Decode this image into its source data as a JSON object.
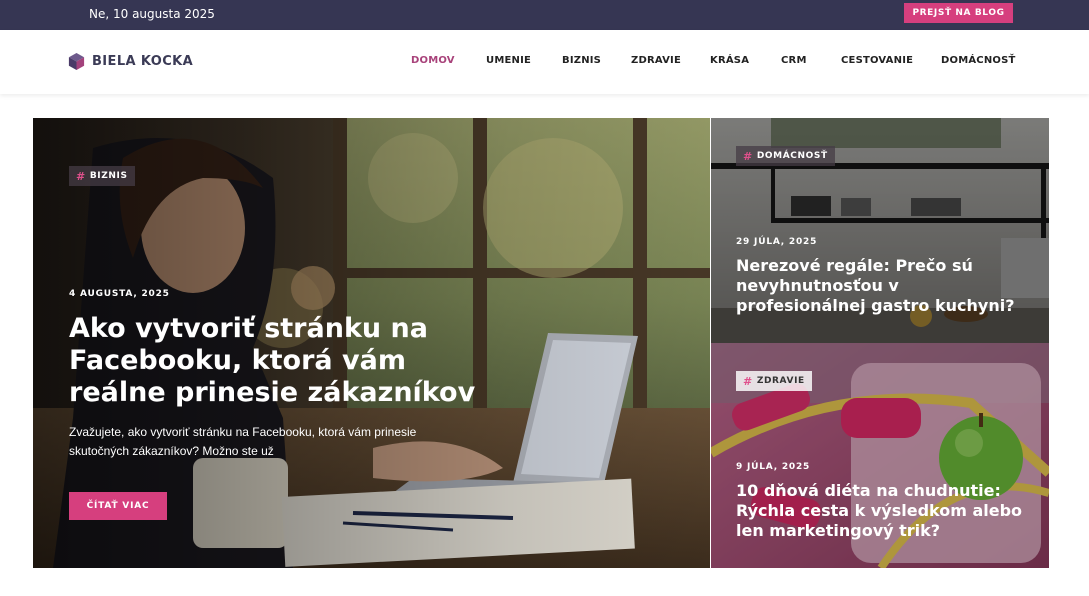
{
  "topbar": {
    "date": "Ne, 10 augusta 2025",
    "blog_button": "PREJSŤ NA BLOG"
  },
  "brand": {
    "name": "BIELA KOCKA",
    "logo_icon": "cube-icon"
  },
  "nav": {
    "items": [
      {
        "label": "DOMOV",
        "active": true
      },
      {
        "label": "UMENIE",
        "active": false
      },
      {
        "label": "BIZNIS",
        "active": false
      },
      {
        "label": "ZDRAVIE",
        "active": false
      },
      {
        "label": "KRÁSA",
        "active": false
      },
      {
        "label": "CRM",
        "active": false
      },
      {
        "label": "CESTOVANIE",
        "active": false
      },
      {
        "label": "DOMÁCNOSŤ",
        "active": false
      }
    ]
  },
  "featured": {
    "category": "BIZNIS",
    "date": "4 AUGUSTA, 2025",
    "title": "Ako vytvoriť stránku na Facebooku, ktorá vám reálne prinesie zákazníkov",
    "excerpt": "Zvažujete, ako vytvoriť stránku na Facebooku, ktorá vám prinesie skutočných zákazníkov? Možno ste už",
    "read_more": "ČÍTAŤ VIAC"
  },
  "side_posts": [
    {
      "category": "DOMÁCNOSŤ",
      "date": "29 JÚLA, 2025",
      "title": "Nerezové regále: Prečo sú nevyhnutnosťou v profesionálnej gastro kuchyni?"
    },
    {
      "category": "ZDRAVIE",
      "date": "9 JÚLA, 2025",
      "title": "10 dňová diéta na chudnutie: Rýchla cesta k výsledkom alebo len marketingový trik?"
    }
  ],
  "colors": {
    "topbar": "#363653",
    "accent": "#d63f7e",
    "nav_active": "#a8427a",
    "brand_text": "#3b3b56"
  }
}
